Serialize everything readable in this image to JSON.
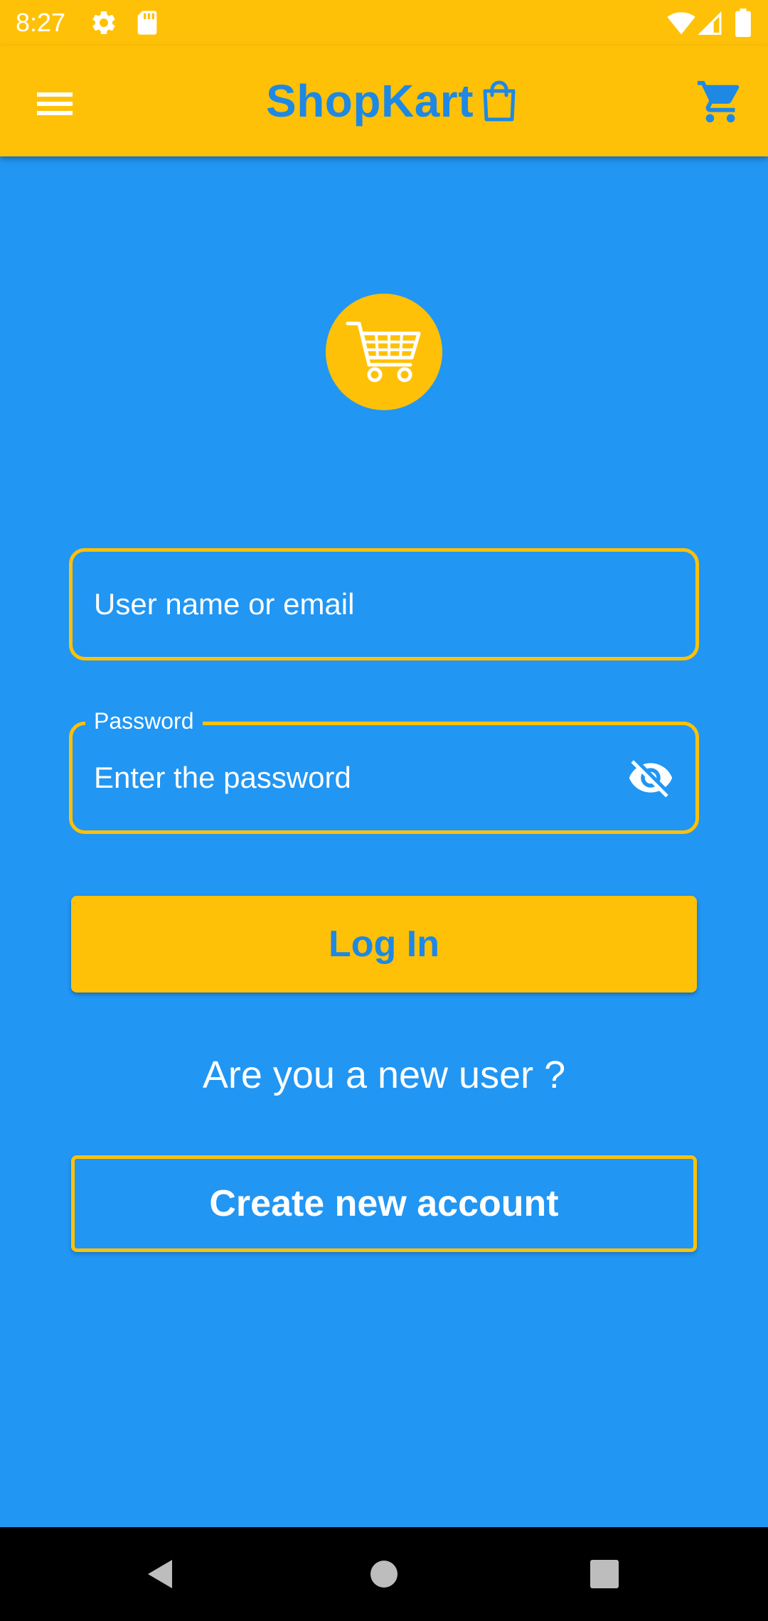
{
  "status_bar": {
    "time": "8:27",
    "icons": [
      "gear-icon",
      "sd-card-icon",
      "wifi-icon",
      "cell-signal-icon",
      "battery-icon"
    ]
  },
  "app_bar": {
    "title": "ShopKart",
    "title_icon": "shopping-bag-icon",
    "menu_icon": "hamburger-menu-icon",
    "cart_icon": "shopping-cart-icon"
  },
  "logo": {
    "icon": "shopping-cart-icon"
  },
  "login_form": {
    "username_placeholder": "User name or email",
    "password_label": "Password",
    "password_placeholder": "Enter the password",
    "password_toggle_icon": "visibility-off-icon",
    "login_button": "Log In",
    "new_user_prompt": "Are you a new user ?",
    "create_account_button": "Create new account"
  },
  "nav_bar": {
    "back": "back-icon",
    "home": "home-icon",
    "recents": "recents-icon"
  },
  "colors": {
    "primary_yellow": "#FFC107",
    "background_blue": "#2196F3",
    "title_blue": "#1E88E5",
    "text_white": "#FFFFFF"
  }
}
